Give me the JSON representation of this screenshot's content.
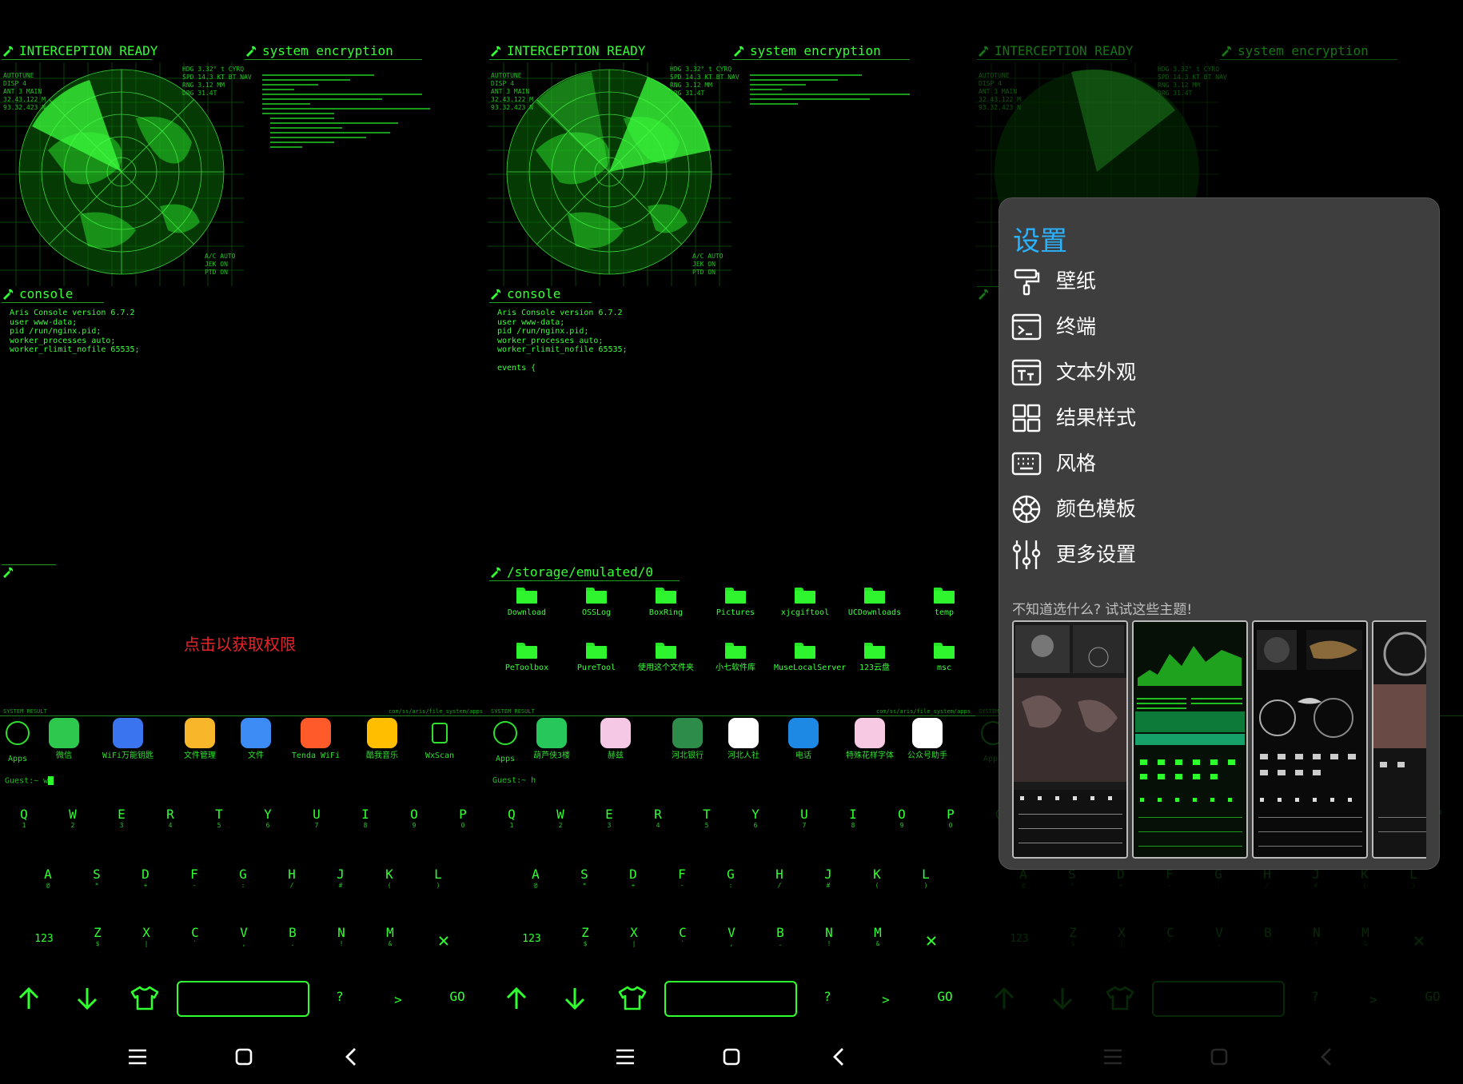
{
  "screen": {
    "width": 1830,
    "height": 1356
  },
  "panels": {
    "radar_title": "INTERCEPTION READY",
    "encrypt_title": "system encryption",
    "console_title": "console",
    "radar_info_left": "AUTOTUNE\nDISP 4\nANT 3 MAIN\n32.43.122 M\n93.32.423 N",
    "radar_info_right": "HDG 3.32° t CYRQ\nSPD 14.3 KT BT NAV\nRNG 3.12 MM\nDRG 31.4T",
    "radar_info_bottom": "A/C AUTO\nJEK ON\nPTD ON",
    "console_lines_1": "Aris Console version 6.7.2\nuser www-data;\npid /run/nginx.pid;\nworker_processes auto;\nworker_rlimit_nofile 65535;",
    "console_lines_2": "Aris Console version 6.7.2\nuser www-data;\npid /run/nginx.pid;\nworker_processes auto;\nworker_rlimit_nofile 65535;\n\nevents {",
    "file_title_1": "",
    "file_title_2": "/storage/emulated/0",
    "permission_text": "点击以获取权限",
    "system_result_left": "SYSTEM RESULT",
    "system_result_right": "com/ss/aris/file_system/apps"
  },
  "folders": [
    "Download",
    "OSSLog",
    "BoxRing",
    "Pictures",
    "xjcgiftool",
    "UCDownloads",
    "temp",
    "PeToolbox",
    "PureTool",
    "使用这个文件夹",
    "小七软件库",
    "MuseLocalServer",
    "123云盘",
    "msc"
  ],
  "apps_1": [
    {
      "label": "Apps",
      "icon": "apps-icon",
      "color": ""
    },
    {
      "label": "微信",
      "icon": "wechat-icon",
      "color": "#2dc84d"
    },
    {
      "label": "WiFi万能钥匙",
      "icon": "wifi-key-icon",
      "color": "#3a74ee"
    },
    {
      "label": "文件管理",
      "icon": "file-manager-icon",
      "color": "#f8b62a"
    },
    {
      "label": "文件",
      "icon": "files-icon",
      "color": "#3d8cf6"
    },
    {
      "label": "Tenda WiFi",
      "icon": "tenda-wifi-icon",
      "color": "#ff5a2a"
    },
    {
      "label": "酷我音乐",
      "icon": "kuwo-music-icon",
      "color": "#ffbf00"
    },
    {
      "label": "WxScan",
      "icon": "wxscan-icon",
      "color": ""
    }
  ],
  "apps_2": [
    {
      "label": "Apps",
      "icon": "apps-icon",
      "color": ""
    },
    {
      "label": "葫芦侠3楼",
      "icon": "huluxia-icon",
      "color": "#27c75b"
    },
    {
      "label": "赫兹",
      "icon": "hertz-icon",
      "color": "#f5c8e6"
    },
    {
      "label": "河北银行",
      "icon": "hebei-bank-icon",
      "color": "#2e8c4a"
    },
    {
      "label": "河北人社",
      "icon": "hebei-renshe-icon",
      "color": "#ffffff"
    },
    {
      "label": "电话",
      "icon": "phone-icon",
      "color": "#1e88e5"
    },
    {
      "label": "特殊花样字体",
      "icon": "font-icon",
      "color": "#f7c9e3"
    },
    {
      "label": "公众号助手",
      "icon": "mp-assistant-icon",
      "color": "#ffffff"
    }
  ],
  "prompt_1": "Guest:~ w",
  "prompt_2": "Guest:~ h",
  "keyboard": {
    "row1": [
      [
        "Q",
        "1"
      ],
      [
        "W",
        "2"
      ],
      [
        "E",
        "3"
      ],
      [
        "R",
        "4"
      ],
      [
        "T",
        "5"
      ],
      [
        "Y",
        "6"
      ],
      [
        "U",
        "7"
      ],
      [
        "I",
        "8"
      ],
      [
        "O",
        "9"
      ],
      [
        "P",
        "0"
      ]
    ],
    "row2": [
      [
        "A",
        "@"
      ],
      [
        "S",
        "*"
      ],
      [
        "D",
        "+"
      ],
      [
        "F",
        "-"
      ],
      [
        "G",
        ":"
      ],
      [
        "H",
        "/"
      ],
      [
        "J",
        "#"
      ],
      [
        "K",
        "("
      ],
      [
        "L",
        ")"
      ]
    ],
    "row3": [
      [
        "Z",
        "$"
      ],
      [
        "X",
        "|"
      ],
      [
        "C",
        "`"
      ],
      [
        "V",
        ","
      ],
      [
        "B",
        "."
      ],
      [
        "N",
        "!"
      ],
      [
        "M",
        "&"
      ]
    ],
    "num_key": "123",
    "question": "?",
    "greater": ">",
    "go": "GO",
    "delete_symbol": "✕"
  },
  "settings_overlay": {
    "title": "设置",
    "items": [
      {
        "label": "壁纸",
        "icon": "paint-roller-icon"
      },
      {
        "label": "终端",
        "icon": "terminal-icon"
      },
      {
        "label": "文本外观",
        "icon": "text-appearance-icon"
      },
      {
        "label": "结果样式",
        "icon": "grid-icon"
      },
      {
        "label": "风格",
        "icon": "keyboard-icon"
      },
      {
        "label": "颜色模板",
        "icon": "palette-wheel-icon"
      },
      {
        "label": "更多设置",
        "icon": "sliders-icon"
      }
    ],
    "hint": "不知道选什么? 试试这些主题!"
  }
}
